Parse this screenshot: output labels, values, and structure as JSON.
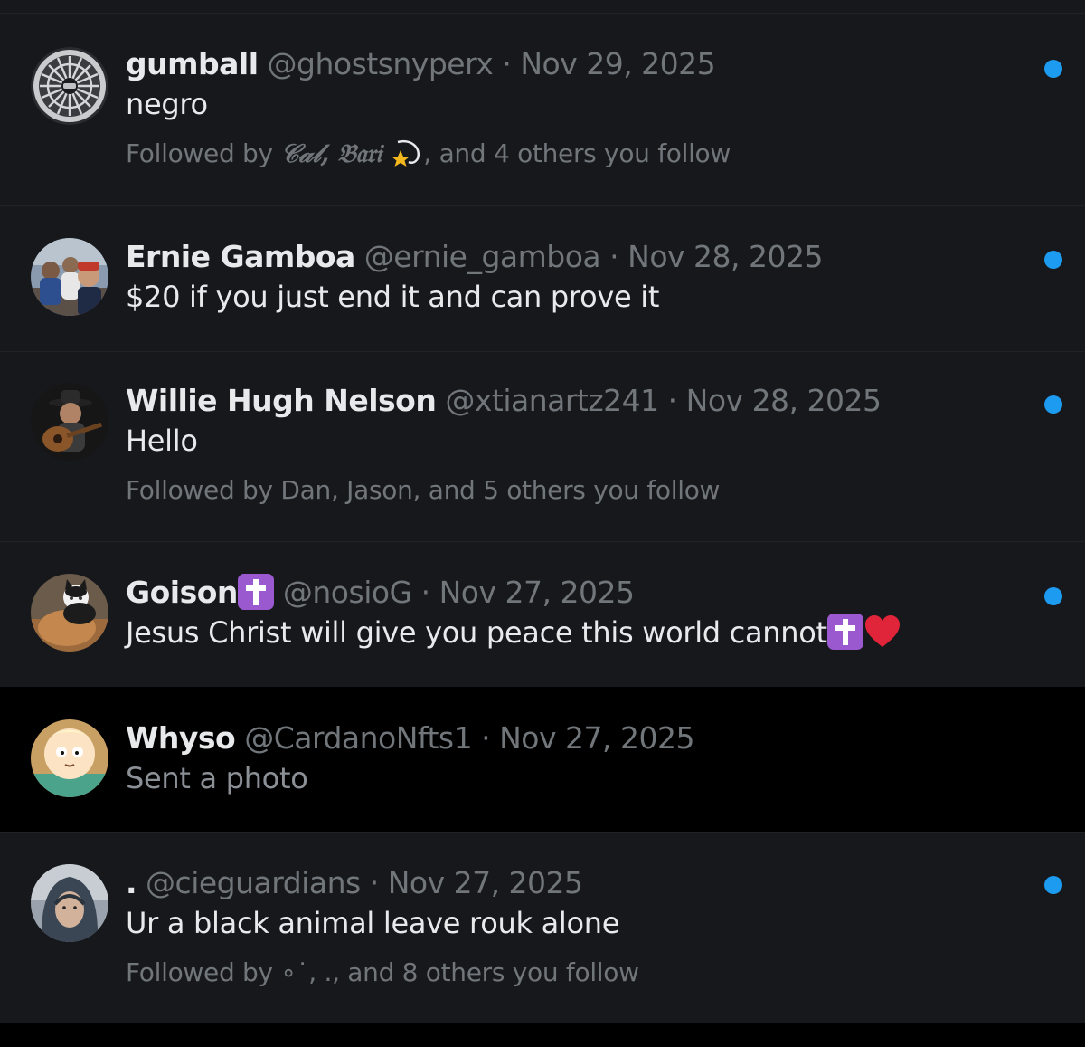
{
  "colors": {
    "unread_bg": "#16181c",
    "read_bg": "#000000",
    "name": "#e7e9ea",
    "secondary": "#71767b",
    "unread_dot": "#1d9bf0"
  },
  "conversations": [
    {
      "name": "gumball",
      "handle": "@ghostsnyperx",
      "separator": "·",
      "date": "Nov 29, 2025",
      "message": "negro",
      "followed_prefix": "Followed by ",
      "followed_names": "𝒞𝒶𝓁, 𝔅𝔞𝔯𝔦",
      "followed_suffix": ", and 4 others you follow",
      "avatar_icon": "car-wheel-avatar",
      "unread": true
    },
    {
      "name": "Ernie Gamboa",
      "handle": "@ernie_gamboa",
      "separator": "·",
      "date": "Nov 28, 2025",
      "message": "$20 if you just end it and can prove it",
      "avatar_icon": "group-photo-avatar",
      "unread": true
    },
    {
      "name": "Willie Hugh Nelson",
      "handle": "@xtianartz241",
      "separator": "·",
      "date": "Nov 28, 2025",
      "message": "Hello",
      "followed": "Followed by Dan, Jason, and 5 others you follow",
      "avatar_icon": "guitarist-avatar",
      "unread": true
    },
    {
      "name": "Goison",
      "handle": "@nosioG",
      "separator": "·",
      "date": "Nov 27, 2025",
      "message": "Jesus Christ will give you peace this world cannot",
      "avatar_icon": "cat-avatar",
      "unread": true
    },
    {
      "name": "Whyso",
      "handle": "@CardanoNfts1",
      "separator": "·",
      "date": "Nov 27, 2025",
      "message": "Sent a photo",
      "avatar_icon": "cartoon-character-avatar",
      "unread": false
    },
    {
      "name": ".",
      "handle": "@cieguardians",
      "separator": "·",
      "date": "Nov 27, 2025",
      "message": "Ur a black animal leave rouk alone",
      "followed": "Followed by ∘˙, ., and 8 others you follow",
      "avatar_icon": "hooded-person-avatar",
      "unread": true
    }
  ]
}
